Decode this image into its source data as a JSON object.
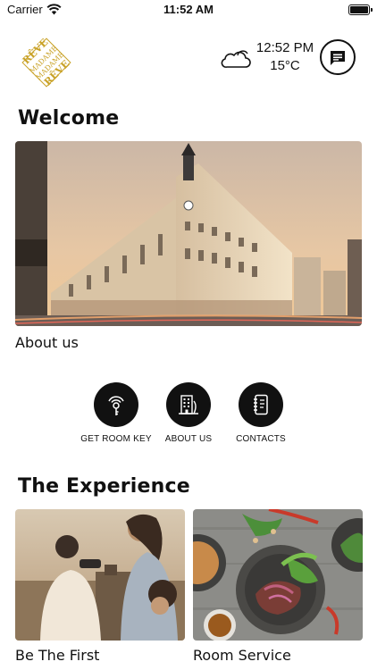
{
  "status_bar": {
    "carrier": "Carrier",
    "time": "11:52 AM"
  },
  "header": {
    "logo_lines": [
      "RÊVE",
      "MADAME",
      "MADAME",
      "RÊVE"
    ],
    "weather": {
      "time": "12:52 PM",
      "temperature": "15°C",
      "icon": "cloud-icon"
    },
    "chat_icon": "message-icon"
  },
  "welcome": {
    "title": "Welcome",
    "hero_caption": "About us"
  },
  "quick_actions": [
    {
      "label": "GET ROOM KEY",
      "icon": "key-icon"
    },
    {
      "label": "ABOUT US",
      "icon": "building-icon"
    },
    {
      "label": "CONTACTS",
      "icon": "address-book-icon"
    }
  ],
  "experience": {
    "title": "The Experience",
    "cards": [
      {
        "caption": "Be The First"
      },
      {
        "caption": "Room Service"
      }
    ]
  },
  "colors": {
    "accent": "#111111",
    "logo_gold": "#c9a227"
  }
}
